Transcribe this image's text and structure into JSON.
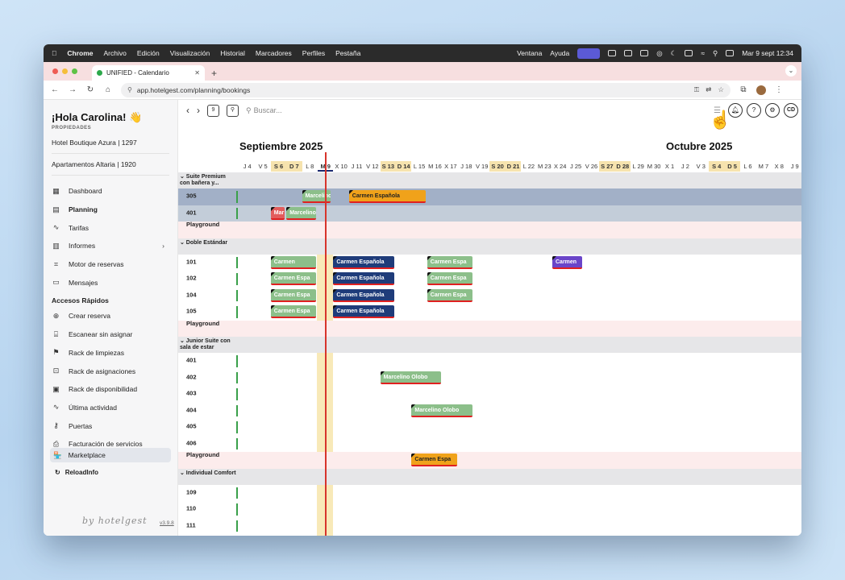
{
  "menubar": {
    "apple": "",
    "app": "Chrome",
    "items": [
      "Archivo",
      "Edición",
      "Visualización",
      "Historial",
      "Marcadores",
      "Perfiles",
      "Pestaña"
    ],
    "right_items": [
      "Ventana",
      "Ayuda"
    ],
    "clock": "Mar 9 sept 12:34"
  },
  "browser": {
    "tab_title": "UNIFIED - Calendario",
    "url": "app.hotelgest.com/planning/bookings",
    "new_tab": "+"
  },
  "sidebar": {
    "greeting": "¡Hola Carolina! 👋",
    "properties_label": "PROPIEDADES",
    "properties": [
      "Hotel Boutique Azura | 1297",
      "Apartamentos Altaria | 1920"
    ],
    "nav": [
      {
        "label": "Dashboard",
        "icon": "dashboard-icon"
      },
      {
        "label": "Planning",
        "icon": "calendar-icon"
      },
      {
        "label": "Tarifas",
        "icon": "trend-icon"
      },
      {
        "label": "Informes",
        "icon": "report-icon"
      },
      {
        "label": "Motor de reservas",
        "icon": "booking-engine-icon"
      },
      {
        "label": "Mensajes",
        "icon": "chat-icon"
      }
    ],
    "quick_title": "Accesos Rápidos",
    "quick": [
      {
        "label": "Crear reserva",
        "icon": "plus-circle-icon"
      },
      {
        "label": "Escanear sin asignar",
        "icon": "scan-icon"
      },
      {
        "label": "Rack de limpiezas",
        "icon": "broom-icon"
      },
      {
        "label": "Rack de asignaciones",
        "icon": "assign-icon"
      },
      {
        "label": "Rack de disponibilidad",
        "icon": "availability-icon"
      },
      {
        "label": "Última actividad",
        "icon": "activity-icon"
      },
      {
        "label": "Puertas",
        "icon": "key-icon"
      },
      {
        "label": "Facturación de servicios",
        "icon": "billing-icon"
      }
    ],
    "marketplace": "Marketplace",
    "reload": "ReloadInfo",
    "brand": "by hotelgest",
    "version": "v3.9.8"
  },
  "toolbar": {
    "search_placeholder": "Buscar...",
    "cal_icon_label": "9",
    "user_initials": "CD"
  },
  "calendar": {
    "month1": "Septiembre 2025",
    "month2": "Octubre 2025",
    "days": [
      {
        "l": "J 4",
        "we": false
      },
      {
        "l": "V 5",
        "we": false
      },
      {
        "l": "S 6",
        "we": true
      },
      {
        "l": "D 7",
        "we": true
      },
      {
        "l": "L 8",
        "we": false
      },
      {
        "l": "M 9",
        "we": false,
        "today": true
      },
      {
        "l": "X 10",
        "we": false
      },
      {
        "l": "J 11",
        "we": false
      },
      {
        "l": "V 12",
        "we": false
      },
      {
        "l": "S 13",
        "we": true
      },
      {
        "l": "D 14",
        "we": true
      },
      {
        "l": "L 15",
        "we": false
      },
      {
        "l": "M 16",
        "we": false
      },
      {
        "l": "X 17",
        "we": false
      },
      {
        "l": "J 18",
        "we": false
      },
      {
        "l": "V 19",
        "we": false
      },
      {
        "l": "S 20",
        "we": true
      },
      {
        "l": "D 21",
        "we": true
      },
      {
        "l": "L 22",
        "we": false
      },
      {
        "l": "M 23",
        "we": false
      },
      {
        "l": "X 24",
        "we": false
      },
      {
        "l": "J 25",
        "we": false
      },
      {
        "l": "V 26",
        "we": false
      },
      {
        "l": "S 27",
        "we": true
      },
      {
        "l": "D 28",
        "we": true
      },
      {
        "l": "L 29",
        "we": false
      },
      {
        "l": "M 30",
        "we": false
      },
      {
        "l": "X 1",
        "we": false
      },
      {
        "l": "J 2",
        "we": false
      },
      {
        "l": "V 3",
        "we": false
      },
      {
        "l": "S 4",
        "we": true
      },
      {
        "l": "D 5",
        "we": true
      },
      {
        "l": "L 6",
        "we": false
      },
      {
        "l": "M 7",
        "we": false
      },
      {
        "l": "X 8",
        "we": false
      },
      {
        "l": "J 9",
        "we": false
      }
    ],
    "rows": [
      {
        "type": "group",
        "label": "Suite Premium con bañera y..."
      },
      {
        "type": "room",
        "label": "305",
        "state": "sel"
      },
      {
        "type": "room",
        "label": "401",
        "state": "sel2"
      },
      {
        "type": "playground",
        "label": "Playground"
      },
      {
        "type": "group",
        "label": "Doble Estándar"
      },
      {
        "type": "room",
        "label": "101"
      },
      {
        "type": "room",
        "label": "102"
      },
      {
        "type": "room",
        "label": "104"
      },
      {
        "type": "room",
        "label": "105"
      },
      {
        "type": "playground",
        "label": "Playground"
      },
      {
        "type": "group",
        "label": "Junior Suite con sala de estar"
      },
      {
        "type": "room",
        "label": "401"
      },
      {
        "type": "room",
        "label": "402"
      },
      {
        "type": "room",
        "label": "403"
      },
      {
        "type": "room",
        "label": "404"
      },
      {
        "type": "room",
        "label": "405"
      },
      {
        "type": "room",
        "label": "406"
      },
      {
        "type": "playground",
        "label": "Playground"
      },
      {
        "type": "group",
        "label": "Individual Comfort"
      },
      {
        "type": "room",
        "label": "109"
      },
      {
        "type": "room",
        "label": "110"
      },
      {
        "type": "room",
        "label": "111"
      }
    ],
    "bookings": [
      {
        "row": 1,
        "start": 4.0,
        "len": 1.8,
        "color": "green",
        "guest": "Marcelino"
      },
      {
        "row": 1,
        "start": 7.0,
        "len": 4.9,
        "color": "orange",
        "guest": "Carmen Española"
      },
      {
        "row": 2,
        "start": 2.0,
        "len": 0.9,
        "color": "red",
        "guest": "Mar"
      },
      {
        "row": 2,
        "start": 3.0,
        "len": 1.9,
        "color": "green",
        "guest": "Marcelino"
      },
      {
        "row": 5,
        "start": 2.0,
        "len": 2.9,
        "color": "green",
        "guest": "Carmen"
      },
      {
        "row": 5,
        "start": 6.0,
        "len": 3.9,
        "color": "navy",
        "guest": "Carmen Española"
      },
      {
        "row": 5,
        "start": 12.0,
        "len": 2.9,
        "color": "green",
        "guest": "Carmen Espa"
      },
      {
        "row": 5,
        "start": 20.0,
        "len": 1.9,
        "color": "purple",
        "guest": "Carmen"
      },
      {
        "row": 6,
        "start": 2.0,
        "len": 2.9,
        "color": "green",
        "guest": "Carmen Espa"
      },
      {
        "row": 6,
        "start": 6.0,
        "len": 3.9,
        "color": "navy",
        "guest": "Carmen Española"
      },
      {
        "row": 6,
        "start": 12.0,
        "len": 2.9,
        "color": "green",
        "guest": "Carmen Espa"
      },
      {
        "row": 7,
        "start": 2.0,
        "len": 2.9,
        "color": "green",
        "guest": "Carmen Espa"
      },
      {
        "row": 7,
        "start": 6.0,
        "len": 3.9,
        "color": "navy",
        "guest": "Carmen Española"
      },
      {
        "row": 7,
        "start": 12.0,
        "len": 2.9,
        "color": "green",
        "guest": "Carmen Espa"
      },
      {
        "row": 8,
        "start": 2.0,
        "len": 2.9,
        "color": "green",
        "guest": "Carmen Espa"
      },
      {
        "row": 8,
        "start": 6.0,
        "len": 3.9,
        "color": "navy",
        "guest": "Carmen Española"
      },
      {
        "row": 12,
        "start": 9.0,
        "len": 3.9,
        "color": "green",
        "guest": "Marcelino Olobo"
      },
      {
        "row": 14,
        "start": 11.0,
        "len": 3.9,
        "color": "green",
        "guest": "Marcelino Olobo"
      },
      {
        "row": 17,
        "start": 11.0,
        "len": 2.9,
        "color": "orange",
        "guest": "Carmen Espa"
      }
    ]
  }
}
